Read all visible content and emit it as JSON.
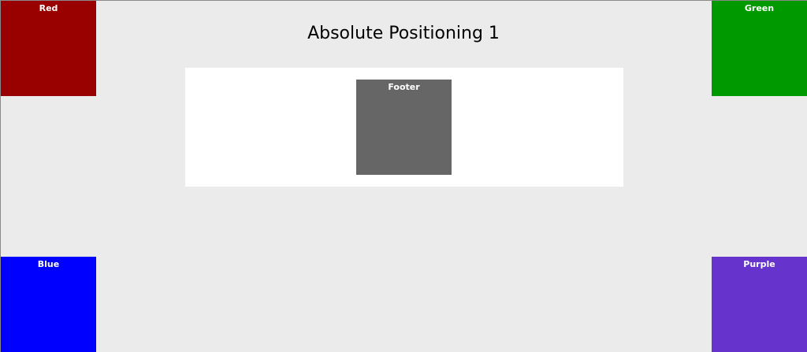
{
  "page": {
    "title": "Absolute Positioning 1"
  },
  "boxes": {
    "red": {
      "label": "Red",
      "color": "#990000"
    },
    "green": {
      "label": "Green",
      "color": "#009900"
    },
    "blue": {
      "label": "Blue",
      "color": "#0000ff"
    },
    "purple": {
      "label": "Purple",
      "color": "#6633cc"
    },
    "footer": {
      "label": "Footer",
      "color": "#666666"
    }
  },
  "colors": {
    "background": "#ebebeb",
    "panel": "#ffffff",
    "title_text": "#000000",
    "box_text": "#ffffff"
  }
}
